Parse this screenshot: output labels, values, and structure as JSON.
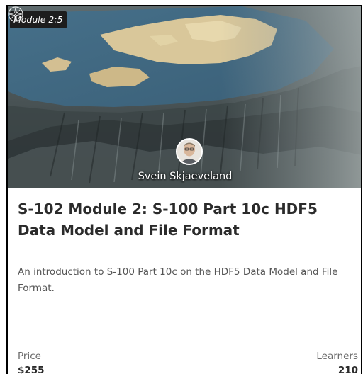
{
  "course": {
    "module_badge": "Module 2:5",
    "instructor_name": "Svein Skjaeveland",
    "title": "S-102 Module 2: S-100 Part 10c HDF5 Data Model and File Format",
    "description": "An introduction to S-100 Part 10c on the HDF5 Data Model and File Format."
  },
  "meta": {
    "price_label": "Price",
    "price_value": "$255",
    "learners_label": "Learners",
    "learners_value": "210"
  },
  "icons": {
    "logo": "compass-rose-icon",
    "avatar": "instructor-avatar"
  },
  "colors": {
    "title": "#2b2b2b",
    "body_text": "#555555",
    "badge_background": "#1d1d1d"
  }
}
